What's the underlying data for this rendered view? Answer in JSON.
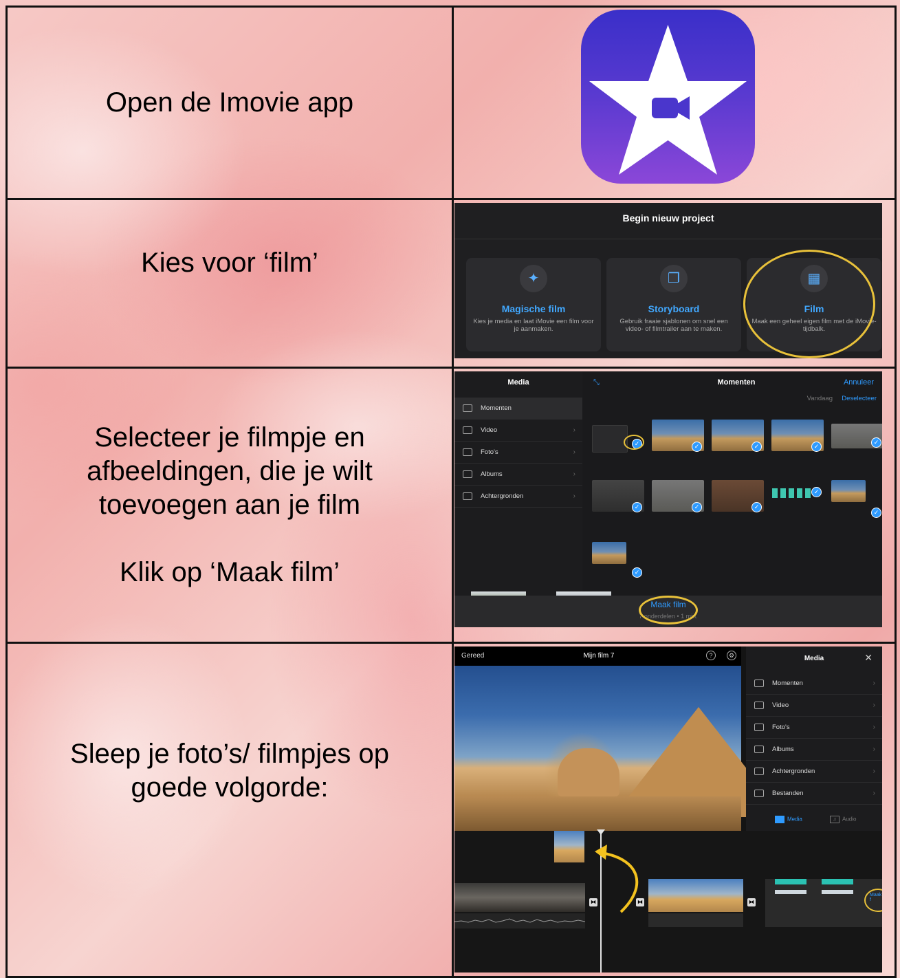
{
  "rows": [
    {
      "text": "Open de Imovie app"
    },
    {
      "text": "Kies voor ‘film’"
    },
    {
      "text": "Selecteer je filmpje en\nafbeeldingen, die je wilt\ntoevoegen aan je film\n\nKlik op ‘Maak film’"
    },
    {
      "text": "Sleep je foto’s/ filmpjes op\ngoede volgorde:"
    }
  ],
  "icons": {
    "app": "imovie-star-camera-icon",
    "magic": "magic-wand-sparkles-icon",
    "storyboard": "storyboard-stack-icon",
    "film": "film-strip-icon"
  },
  "colors": {
    "icon_gradient_top": "#3a2fc9",
    "icon_gradient_bottom": "#8b47d8",
    "highlight_ring": "#e8c13a",
    "ios_blue": "#2f9bff"
  },
  "new_project": {
    "title": "Begin nieuw project",
    "cards": [
      {
        "label": "Magische film",
        "desc": "Kies je media en laat iMovie een film voor je aanmaken."
      },
      {
        "label": "Storyboard",
        "desc": "Gebruik fraaie sjablonen om snel een video- of filmtrailer aan te maken."
      },
      {
        "label": "Film",
        "desc": "Maak een geheel eigen film met de iMovie-tijdbalk."
      }
    ]
  },
  "media_picker": {
    "sidebar_title": "Media",
    "main_title": "Momenten",
    "cancel": "Annuleer",
    "today": "Vandaag",
    "deselect": "Deselecteer",
    "items": [
      "Momenten",
      "Video",
      "Foto's",
      "Albums",
      "Achtergronden"
    ],
    "make_film": "Maak film",
    "footer_hint": "7 onderdelen • 1 min."
  },
  "editor": {
    "done": "Gereed",
    "project_title": "Mijn film 7",
    "media_title": "Media",
    "items": [
      "Momenten",
      "Video",
      "Foto's",
      "Albums",
      "Achtergronden",
      "Bestanden"
    ],
    "tab_media": "Media",
    "tab_audio": "Audio",
    "make_film_cut": "Maak f"
  }
}
